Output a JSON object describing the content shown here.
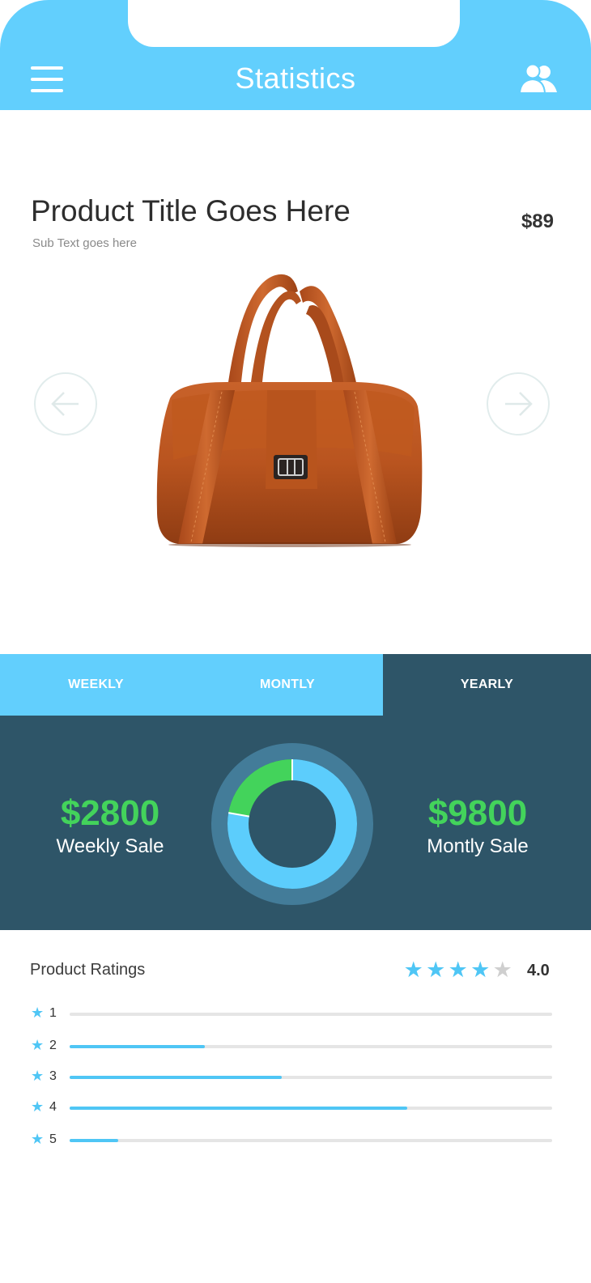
{
  "header": {
    "title": "Statistics",
    "menu_icon": "hamburger-menu-icon",
    "users_icon": "users-icon",
    "color": "#62cffd"
  },
  "product": {
    "title": "Product Title Goes Here",
    "subtitle": "Sub Text goes here",
    "price": "$89",
    "image": "brown-leather-handbag",
    "prev_icon": "arrow-left-icon",
    "next_icon": "arrow-right-icon"
  },
  "tabs": [
    {
      "label": "WEEKLY",
      "active": false
    },
    {
      "label": "MONTLY",
      "active": false
    },
    {
      "label": "YEARLY",
      "active": true
    }
  ],
  "sales": {
    "weekly": {
      "value": "$2800",
      "label": "Weekly Sale"
    },
    "monthly": {
      "value": "$9800",
      "label": "Montly Sale"
    },
    "accent_color": "#43d35b",
    "panel_color": "#2e5568"
  },
  "chart_data": {
    "type": "pie",
    "donut": true,
    "series": [
      {
        "value": 2800,
        "color": "#43d35b"
      },
      {
        "value": 9800,
        "color": "#5ccdfc"
      }
    ]
  },
  "ratings": {
    "label": "Product Ratings",
    "score": "4.0",
    "stars_filled": 4,
    "stars_total": 5,
    "star_color": "#4fc6f5",
    "rows": [
      {
        "stars": "1",
        "fraction": 0.0
      },
      {
        "stars": "2",
        "fraction": 0.28
      },
      {
        "stars": "3",
        "fraction": 0.44
      },
      {
        "stars": "4",
        "fraction": 0.7
      },
      {
        "stars": "5",
        "fraction": 0.1
      }
    ]
  }
}
